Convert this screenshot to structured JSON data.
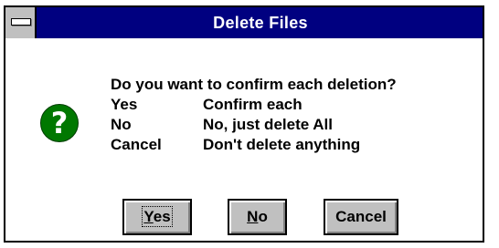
{
  "window": {
    "title": "Delete Files"
  },
  "icon": {
    "name": "question-icon",
    "glyph": "?",
    "color": "#007800"
  },
  "message": {
    "question": "Do you want to confirm each deletion?",
    "options": [
      {
        "key": "Yes",
        "description": "Confirm each"
      },
      {
        "key": "No",
        "description": "No, just delete All"
      },
      {
        "key": "Cancel",
        "description": "Don't delete anything"
      }
    ]
  },
  "buttons": {
    "yes": {
      "mnemonic": "Y",
      "rest": "es",
      "default": true
    },
    "no": {
      "mnemonic": "N",
      "rest": "o"
    },
    "cancel": {
      "label": "Cancel"
    }
  },
  "colors": {
    "titlebar": "#000080",
    "button_face": "#c0c0c0",
    "background": "#ffffff"
  }
}
